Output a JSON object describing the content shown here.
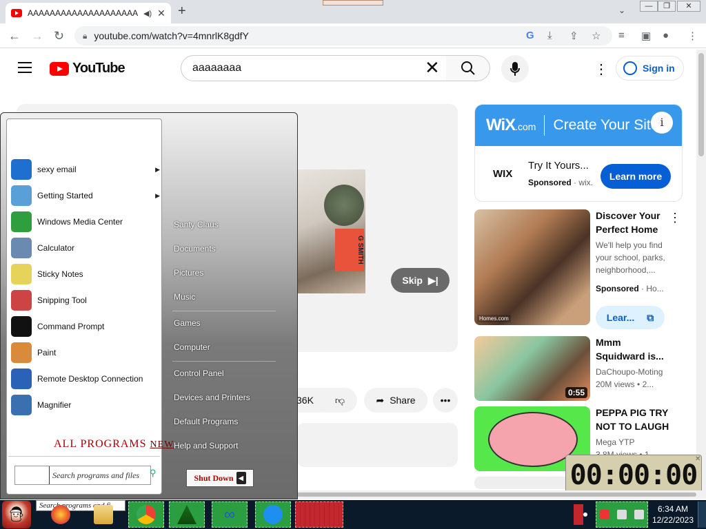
{
  "browser": {
    "tab_title": "AAAAAAAAAAAAAAAAAAAA",
    "new_tab_symbol": "+",
    "url": "youtube.com/watch?v=4mnrlK8gdfY",
    "window_controls": [
      "—",
      "❐",
      "✕"
    ]
  },
  "youtube": {
    "logo_text": "YouTube",
    "search_value": "aaaaaaaa",
    "sign_in": "Sign in",
    "skip_label": "Skip",
    "book_text": "G SMITH",
    "like_count": "36K",
    "share_label": "Share",
    "ad": {
      "brand": "WiX",
      "brand_suffix": ".com",
      "headline": "Create Your Site",
      "logo_text": "WIX",
      "title": "Try It Yours...",
      "sponsored": "Sponsored",
      "domain": "wix.",
      "cta": "Learn more"
    },
    "recommendations": [
      {
        "title": "Discover Your Perfect Home",
        "desc": "We'll help you find your school, parks, neighborhood,...",
        "sponsored": "Sponsored",
        "source": "Ho...",
        "cta": "Lear...",
        "thumb_tag": "Homes.com"
      },
      {
        "title": "Mmm Squidward is...",
        "channel": "DaChoupo-Moting",
        "views": "20M views",
        "age": "2...",
        "duration": "0:55"
      },
      {
        "title": "PEPPA PIG TRY NOT TO LAUGH",
        "channel": "Mega YTP",
        "views": "3.8M views",
        "age": "1..."
      }
    ]
  },
  "timer_widget": {
    "display": "00:00:00"
  },
  "start_menu": {
    "left_items": [
      {
        "label": "sexy email",
        "icon": "thunderbird-icon",
        "color": "#1e6fd0",
        "has_submenu": true
      },
      {
        "label": "Getting Started",
        "icon": "getting-started-icon",
        "color": "#5aa0d8",
        "has_submenu": true
      },
      {
        "label": "Windows Media Center",
        "icon": "media-center-icon",
        "color": "#2f9e3e",
        "has_submenu": false
      },
      {
        "label": "Calculator",
        "icon": "calculator-icon",
        "color": "#6a8ab0",
        "has_submenu": false
      },
      {
        "label": "Sticky Notes",
        "icon": "sticky-notes-icon",
        "color": "#e6d35a",
        "has_submenu": false
      },
      {
        "label": "Snipping Tool",
        "icon": "snipping-tool-icon",
        "color": "#c44",
        "has_submenu": false
      },
      {
        "label": "Command Prompt",
        "icon": "command-prompt-icon",
        "color": "#111111",
        "has_submenu": false
      },
      {
        "label": "Paint",
        "icon": "paint-icon",
        "color": "#d98a3a",
        "has_submenu": false
      },
      {
        "label": "Remote Desktop Connection",
        "icon": "remote-desktop-icon",
        "color": "#2a62b8",
        "has_submenu": false
      },
      {
        "label": "Magnifier",
        "icon": "magnifier-icon",
        "color": "#3a6fb0",
        "has_submenu": false
      }
    ],
    "all_programs": "ALL PROGRAMS",
    "all_programs_new": "NEW",
    "search_placeholder": "Search programs and files",
    "right_items": [
      "Santy Claus",
      "Documents",
      "Pictures",
      "Music",
      "Games",
      "Computer",
      "Control Panel",
      "Devices and Printers",
      "Default Programs",
      "Help and Support"
    ],
    "shutdown_label": "Shut Down"
  },
  "taskbar": {
    "search_peek": "Search programs and fi",
    "time": "6:34 AM",
    "date": "12/22/2023"
  }
}
